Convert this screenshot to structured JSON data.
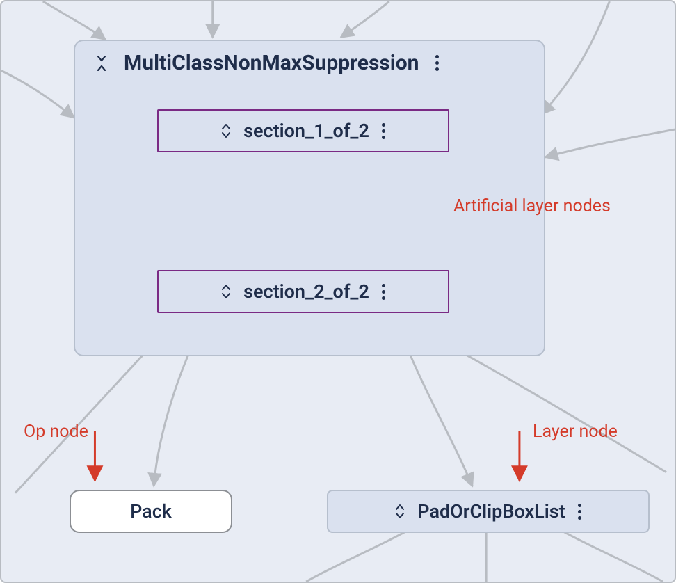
{
  "nodes": {
    "group_title": "MultiClassNonMaxSuppression",
    "section_1": "section_1_of_2",
    "section_2": "section_2_of_2",
    "op_node": "Pack",
    "layer_node": "PadOrClipBoxList"
  },
  "annotations": {
    "artificial": "Artificial layer nodes",
    "op_node": "Op node",
    "layer_node": "Layer node"
  },
  "colors": {
    "bg": "#e8ecf4",
    "node_fill": "#dae1ef",
    "node_border": "#b6bfcd",
    "section_border": "#7a2a84",
    "op_fill": "#ffffff",
    "op_border": "#8c8f94",
    "text": "#1f2d4a",
    "annotation": "#d43b2a",
    "edge": "#b8bcc2"
  }
}
